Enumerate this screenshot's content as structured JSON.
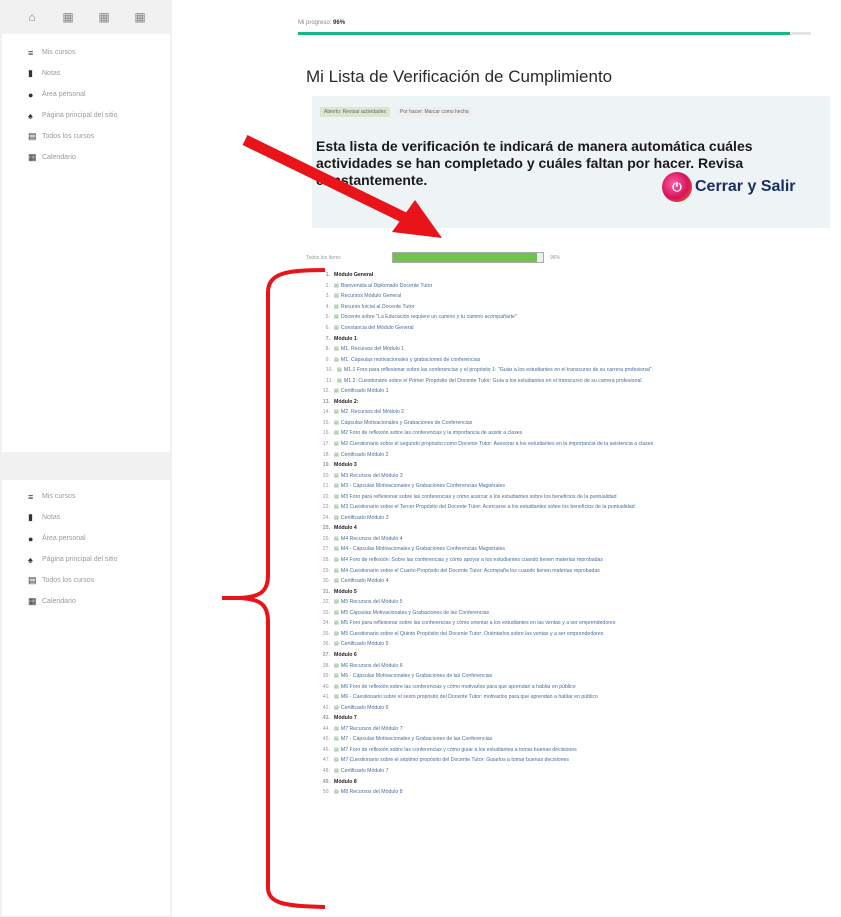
{
  "top_icons": [
    "⌂",
    "▦",
    "▦",
    "▦"
  ],
  "sidebar": {
    "items": [
      {
        "icon": "≡",
        "label": "Mis cursos"
      },
      {
        "icon": "▮",
        "label": "Notas"
      },
      {
        "icon": "●",
        "label": "Área personal"
      },
      {
        "icon": "♠",
        "label": "Página principal del sitio"
      },
      {
        "icon": "▤",
        "label": "Todos los cursos"
      },
      {
        "icon": "▦",
        "label": "Calendario"
      }
    ],
    "items_bottom": [
      {
        "icon": "≡",
        "label": "Mis cursos"
      },
      {
        "icon": "▮",
        "label": "Notas"
      },
      {
        "icon": "●",
        "label": "Área personal"
      },
      {
        "icon": "♠",
        "label": "Página principal del sitio"
      },
      {
        "icon": "▤",
        "label": "Todos los cursos"
      },
      {
        "icon": "▦",
        "label": "Calendario"
      }
    ]
  },
  "header": {
    "breadcrumb_prefix": "Mi progreso:",
    "breadcrumb_value": "96%",
    "progress": 0.96
  },
  "page_title": "Mi Lista de Verificación de Cumplimiento",
  "info": {
    "tag1": "Abierto: Revisar actividades",
    "tag2": "Por hacer: Marcar como hecha",
    "text": "Esta lista de verificación te indicará de manera automática cuáles actividades se han completado y cuáles faltan por hacer. Revisa constantemente.",
    "exit_label": "Cerrar y Salir"
  },
  "overall": {
    "label": "Todos los ítems",
    "percent_label": "96%",
    "progress": 0.96
  },
  "checklist": [
    {
      "n": "1.",
      "text": "Módulo General",
      "type": "sec"
    },
    {
      "n": "2.",
      "text": "Bienvenida al Diplomado Docente Tutor",
      "type": "item"
    },
    {
      "n": "3.",
      "text": "Recursos Módulo General",
      "type": "item"
    },
    {
      "n": "4.",
      "text": "Recurso Inicial al Docente Tutor",
      "type": "item"
    },
    {
      "n": "5.",
      "text": "Docente sobre \"La Educación requiere un camino y tu camino acompañarte\"",
      "type": "item"
    },
    {
      "n": "6.",
      "text": "Constancia del Módulo General",
      "type": "item"
    },
    {
      "n": "7.",
      "text": "Módulo 1",
      "type": "sec"
    },
    {
      "n": "8.",
      "text": "M1. Recursos del Módulo 1",
      "type": "item"
    },
    {
      "n": "9.",
      "text": "M1. Cápsulas motivacionales y grabaciones de conferencias",
      "type": "item"
    },
    {
      "n": "10.",
      "text": "M1.1 Foro para reflexionar sobre las conferencias y el propósito 1: \"Guiar a los estudiantes en el transcurso de su carrera profesional\"",
      "type": "sub"
    },
    {
      "n": "11.",
      "text": "M1.2: Cuestionario sobre el Primer Propósito del Docente Tutor: Guía a los estudiantes en el transcurso de su carrera profesional",
      "type": "sub"
    },
    {
      "n": "12.",
      "text": "Certificado Módulo 1",
      "type": "item"
    },
    {
      "n": "13.",
      "text": "Módulo 2:",
      "type": "sec"
    },
    {
      "n": "14.",
      "text": "M2. Recursos del Módulo 2",
      "type": "item"
    },
    {
      "n": "15.",
      "text": "Cápsulas Motivacionales y Grabaciones de Conferencias",
      "type": "item"
    },
    {
      "n": "16.",
      "text": "M2 Foro de reflexión sobre las conferencias y la importancia de asistir a clases",
      "type": "item"
    },
    {
      "n": "17.",
      "text": "M2 Cuestionario sobre el segundo propósito como Docente Tutor: Asesorar a los estudiantes en la importancia de la asistencia a clases",
      "type": "item"
    },
    {
      "n": "18.",
      "text": "Certificado Módulo 2",
      "type": "item"
    },
    {
      "n": "19.",
      "text": "Módulo 3",
      "type": "sec"
    },
    {
      "n": "20.",
      "text": "M3 Recursos del Módulo 3",
      "type": "item"
    },
    {
      "n": "21.",
      "text": "M3 - Cápsulas Motivacionales y Grabaciones Conferencias Magistrales",
      "type": "item"
    },
    {
      "n": "22.",
      "text": "M3 Foro para reflexionar sobre las conferencias y cómo acercar a los estudiantes sobre los beneficios de la puntualidad",
      "type": "item"
    },
    {
      "n": "23.",
      "text": "M3 Cuestionario sobre el Tercer Propósito del Docente Tutor: Acercarse a los estudiantes sobre los beneficios de la puntualidad",
      "type": "item"
    },
    {
      "n": "24.",
      "text": "Certificado Módulo 3",
      "type": "item"
    },
    {
      "n": "25.",
      "text": "Módulo 4",
      "type": "sec"
    },
    {
      "n": "26.",
      "text": "M4 Recursos del Módulo 4",
      "type": "item"
    },
    {
      "n": "27.",
      "text": "M4 - Cápsulas Motivacionales y Grabaciones Conferencias Magistrales",
      "type": "item"
    },
    {
      "n": "28.",
      "text": "M4 Foro de reflexión: Sobre las conferencias y cómo apoyar a los estudiantes cuando tienen materias reprobadas",
      "type": "item"
    },
    {
      "n": "29.",
      "text": "M4 Cuestionario sobre el Cuarto Propósito del Docente Tutor: Acompaña los cuando tienen materias reprobadas",
      "type": "item"
    },
    {
      "n": "30.",
      "text": "Certificado Módulo 4",
      "type": "item"
    },
    {
      "n": "31.",
      "text": "Módulo 5",
      "type": "sec"
    },
    {
      "n": "32.",
      "text": "M5 Recursos del Módulo 5",
      "type": "item"
    },
    {
      "n": "33.",
      "text": "M5 Cápsulas Motivacionales y Grabaciones de las Conferencias",
      "type": "item"
    },
    {
      "n": "34.",
      "text": "M5 Foro para reflexionar sobre las conferencias y cómo orientar a los estudiantes en las ventas y a ser emprendedores",
      "type": "item"
    },
    {
      "n": "35.",
      "text": "M5 Cuestionario sobre el Quinto Propósito del Docente Tutor: Oriéntarlos sobre las ventas y a ser emprendedores",
      "type": "item"
    },
    {
      "n": "36.",
      "text": "Certificado Módulo 5",
      "type": "item"
    },
    {
      "n": "37.",
      "text": "Módulo 6",
      "type": "sec"
    },
    {
      "n": "38.",
      "text": "M6 Recursos del Módulo 6",
      "type": "item"
    },
    {
      "n": "39.",
      "text": "M6 - Cápsulas Motivacionales y Grabaciones de las Conferencias",
      "type": "item"
    },
    {
      "n": "40.",
      "text": "M6 Foro de reflexión sobre las conferencias y cómo motivarlos para que aprendan a hablar en público",
      "type": "item"
    },
    {
      "n": "41.",
      "text": "M6 - Cuestionario sobre el sexto propósito del Docente Tutor: motivarlos para que aprendan a hablar en público",
      "type": "item"
    },
    {
      "n": "42.",
      "text": "Certificado Módulo 6",
      "type": "item"
    },
    {
      "n": "43.",
      "text": "Módulo 7",
      "type": "sec"
    },
    {
      "n": "44.",
      "text": "M7 Recursos del Módulo 7",
      "type": "item"
    },
    {
      "n": "45.",
      "text": "M7 - Cápsulas Motivacionales y Grabaciones de las Conferencias",
      "type": "item"
    },
    {
      "n": "46.",
      "text": "M7 Foro de reflexión sobre las conferencias y cómo guiar a los estudiantes a tomar buenas decisiones",
      "type": "item"
    },
    {
      "n": "47.",
      "text": "M7 Cuestionario sobre el séptimo propósito del Docente Tutor: Guiarlos a tomar buenas decisiones",
      "type": "item"
    },
    {
      "n": "48.",
      "text": "Certificado Módulo 7",
      "type": "item"
    },
    {
      "n": "49.",
      "text": "Módulo 8",
      "type": "sec"
    },
    {
      "n": "50.",
      "text": "M8 Recursos del Módulo 8",
      "type": "item"
    }
  ]
}
